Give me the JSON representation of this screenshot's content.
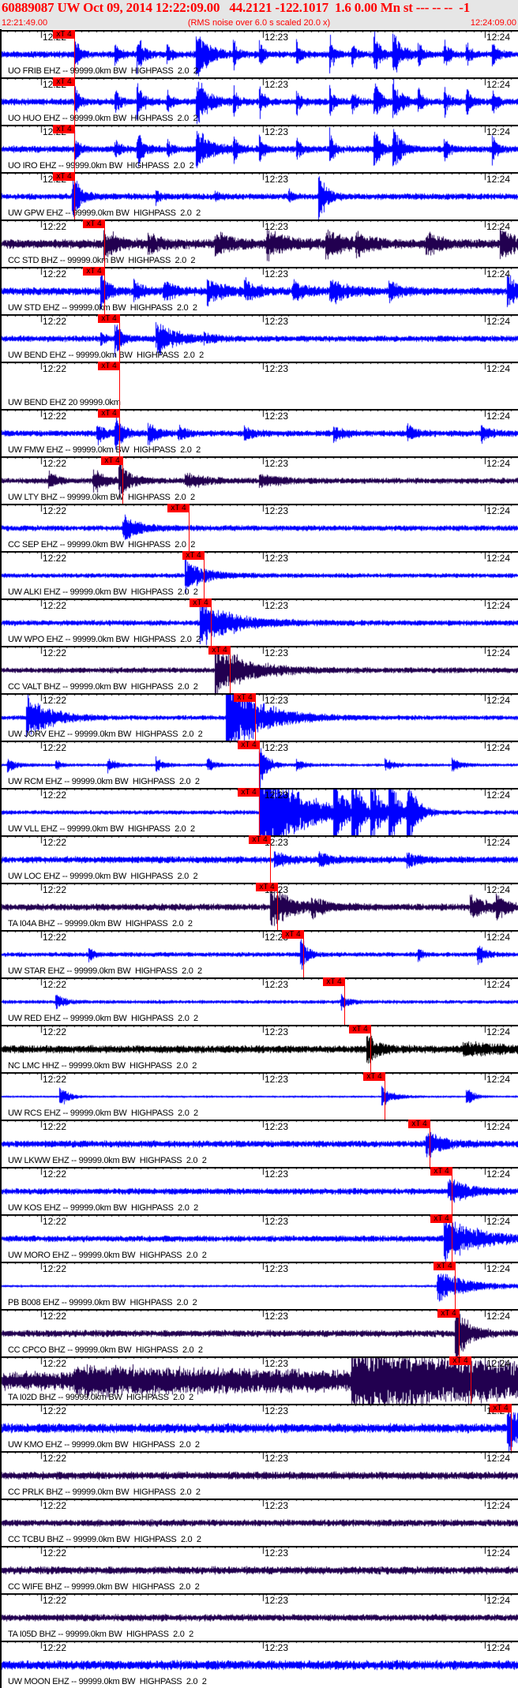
{
  "header": {
    "title": "60889087 UW Oct 09, 2014 12:22:09.00   44.2121 -122.1017  1.6 0.00 Mn st --- -- --  -1",
    "start_time": "12:21:49.00",
    "end_time": "12:24:09.00",
    "rms_note": "(RMS noise over 6.0 s scaled 20.0 x)"
  },
  "axis": {
    "window_seconds": 140,
    "tick_labels": [
      {
        "label": "12:22",
        "t": 11
      },
      {
        "label": "12:23",
        "t": 71
      },
      {
        "label": "12:24",
        "t": 131
      }
    ],
    "pick_label": "xT 4"
  },
  "colors": {
    "blue": "#0000ff",
    "purple": "#220050",
    "black": "#000000",
    "pick": "#ff0000",
    "header_bg": "#e6e6e6"
  },
  "traces": [
    {
      "label": "UO FRIB EHZ -- 99999.0km BW  HIGHPASS  2.0  2",
      "color": "blue",
      "pick_s": 20.1,
      "noise": 0.22,
      "events": [
        [
          20,
          1.3,
          1
        ],
        [
          31,
          0.9,
          1
        ],
        [
          37,
          1.3,
          1.5
        ],
        [
          45,
          0.8,
          1
        ],
        [
          53,
          1.6,
          3
        ],
        [
          63,
          1.0,
          1
        ],
        [
          70,
          1.1,
          1
        ],
        [
          80,
          1.0,
          1
        ],
        [
          89,
          1.3,
          1
        ],
        [
          95,
          0.8,
          1
        ],
        [
          101,
          1.5,
          1.5
        ],
        [
          106,
          1.6,
          2
        ],
        [
          113,
          0.8,
          1
        ],
        [
          120,
          1.3,
          1
        ],
        [
          126,
          0.9,
          1
        ],
        [
          133,
          1.0,
          1
        ]
      ]
    },
    {
      "label": "UO HUO EHZ -- 99999.0km BW  HIGHPASS  2.0  2",
      "color": "blue",
      "pick_s": 20.1,
      "noise": 0.22,
      "events": [
        [
          20,
          1.3,
          1
        ],
        [
          31,
          1.0,
          1
        ],
        [
          37,
          1.2,
          1.5
        ],
        [
          45,
          0.9,
          1
        ],
        [
          53,
          1.6,
          3
        ],
        [
          63,
          1.0,
          1
        ],
        [
          70,
          1.2,
          1
        ],
        [
          80,
          0.9,
          1
        ],
        [
          89,
          1.3,
          1
        ],
        [
          95,
          0.9,
          1
        ],
        [
          101,
          1.6,
          1.5
        ],
        [
          106,
          1.6,
          2
        ],
        [
          113,
          0.9,
          1
        ],
        [
          120,
          1.2,
          1
        ],
        [
          126,
          1.0,
          1
        ],
        [
          133,
          1.0,
          1
        ]
      ]
    },
    {
      "label": "UO IRO EHZ -- 99999.0km BW  HIGHPASS  2.0  2",
      "color": "blue",
      "pick_s": 20.1,
      "noise": 0.22,
      "events": [
        [
          20,
          1.3,
          1
        ],
        [
          31,
          0.8,
          1
        ],
        [
          37,
          1.2,
          1.5
        ],
        [
          45,
          0.8,
          1
        ],
        [
          53,
          1.6,
          3
        ],
        [
          63,
          1.0,
          1
        ],
        [
          70,
          1.2,
          1
        ],
        [
          80,
          0.9,
          1
        ],
        [
          89,
          1.3,
          1
        ],
        [
          101,
          1.6,
          1.5
        ],
        [
          106,
          1.6,
          2
        ],
        [
          120,
          1.2,
          1
        ],
        [
          133,
          1.0,
          1
        ]
      ]
    },
    {
      "label": "UW GPW EHZ -- 99999.0km BW  HIGHPASS  2.0  2",
      "color": "blue",
      "pick_s": 20.1,
      "noise": 0.2,
      "events": [
        [
          19.5,
          1.6,
          2
        ],
        [
          42,
          0.5,
          1
        ],
        [
          58,
          0.4,
          1
        ],
        [
          78,
          0.4,
          1
        ],
        [
          86,
          1.6,
          2
        ]
      ]
    },
    {
      "label": "CC STD BHZ -- 99999.0km BW  HIGHPASS  2.0  2",
      "color": "purple",
      "pick_s": 28.2,
      "noise": 0.3,
      "events": [
        [
          28,
          1.0,
          3
        ],
        [
          40,
          0.6,
          3
        ],
        [
          58,
          0.8,
          4
        ],
        [
          72,
          0.9,
          5
        ],
        [
          88,
          0.8,
          5
        ],
        [
          96,
          0.7,
          3
        ],
        [
          115,
          0.8,
          3
        ],
        [
          135,
          1.2,
          3
        ]
      ]
    },
    {
      "label": "UW STD EHZ -- 99999.0km BW  HIGHPASS  2.0  2",
      "color": "blue",
      "pick_s": 28.2,
      "noise": 0.25,
      "events": [
        [
          27,
          1.4,
          2
        ],
        [
          36,
          0.7,
          2
        ],
        [
          44,
          0.6,
          3
        ],
        [
          56,
          0.9,
          4
        ],
        [
          66,
          0.7,
          3
        ],
        [
          79,
          0.7,
          3
        ],
        [
          89,
          0.9,
          4
        ],
        [
          105,
          0.6,
          3
        ],
        [
          137,
          1.4,
          2
        ]
      ]
    },
    {
      "label": "UW BEND EHZ -- 99999.0km BW  HIGHPASS  2.0  2",
      "color": "blue",
      "pick_s": 32.2,
      "noise": 0.2,
      "events": [
        [
          27,
          0.6,
          1
        ],
        [
          31,
          1.2,
          1.5
        ],
        [
          42,
          1.0,
          5
        ],
        [
          55,
          0.3,
          2
        ]
      ]
    },
    {
      "label": "UW BEND EHZ 20 99999.0km",
      "color": "blue",
      "pick_s": 32.2,
      "noise": 0,
      "events": []
    },
    {
      "label": "UW FMW EHZ -- 99999.0km BW  HIGHPASS  2.0  2",
      "color": "blue",
      "pick_s": 32.2,
      "noise": 0.2,
      "events": [
        [
          26,
          0.8,
          2
        ],
        [
          31,
          1.3,
          2
        ],
        [
          40,
          0.8,
          2
        ],
        [
          48,
          0.5,
          2
        ],
        [
          66,
          0.5,
          2
        ],
        [
          90,
          0.6,
          2
        ],
        [
          110,
          0.6,
          2
        ],
        [
          130,
          0.6,
          2
        ]
      ]
    },
    {
      "label": "UW LTY BHZ -- 99999.0km BW  HIGHPASS  2.0  2",
      "color": "purple",
      "pick_s": 33.1,
      "noise": 0.18,
      "events": [
        [
          13,
          0.6,
          2
        ],
        [
          25,
          0.8,
          3
        ],
        [
          32,
          1.2,
          3
        ],
        [
          50,
          0.5,
          5
        ],
        [
          70,
          0.4,
          5
        ],
        [
          140,
          0.5,
          3
        ]
      ]
    },
    {
      "label": "CC SEP EHZ -- 99999.0km BW  HIGHPASS  2.0  2",
      "color": "blue",
      "pick_s": 51.0,
      "noise": 0.18,
      "events": [
        [
          33,
          0.9,
          4
        ],
        [
          140,
          0.4,
          4
        ]
      ]
    },
    {
      "label": "UW ALKI EHZ -- 99999.0km BW  HIGHPASS  2.0  2",
      "color": "blue",
      "pick_s": 55.1,
      "noise": 0.15,
      "events": [
        [
          50,
          1.0,
          5
        ]
      ]
    },
    {
      "label": "UW WPO EHZ -- 99999.0km BW  HIGHPASS  2.0  2",
      "color": "blue",
      "pick_s": 57.0,
      "noise": 0.18,
      "events": [
        [
          54,
          1.5,
          8
        ]
      ]
    },
    {
      "label": "CC VALT BHZ -- 99999.0km BW  HIGHPASS  2.0  2",
      "color": "purple",
      "pick_s": 62.1,
      "noise": 0.18,
      "events": [
        [
          58,
          1.7,
          8
        ]
      ]
    },
    {
      "label": "UW JORV EHZ -- 99999.0km BW  HIGHPASS  2.0  2",
      "color": "blue",
      "pick_s": 68.9,
      "noise": 0.15,
      "events": [
        [
          7,
          1.5,
          6
        ],
        [
          61,
          3,
          8
        ]
      ]
    },
    {
      "label": "UW RCM EHZ -- 99999.0km BW  HIGHPASS  2.0  2",
      "color": "blue",
      "pick_s": 70.0,
      "noise": 0.1,
      "events": [
        [
          2,
          0.5,
          2
        ],
        [
          15,
          0.5,
          1
        ],
        [
          29,
          0.5,
          2
        ],
        [
          42,
          0.5,
          2
        ],
        [
          56,
          0.4,
          2
        ],
        [
          70,
          1.5,
          2
        ],
        [
          80,
          0.4,
          2
        ],
        [
          104,
          0.5,
          2
        ],
        [
          122,
          0.5,
          2
        ]
      ]
    },
    {
      "label": "UW VLL EHZ -- 99999.0km BW  HIGHPASS  2.0  2",
      "color": "blue",
      "pick_s": 70.0,
      "noise": 0.14,
      "events": [
        [
          70,
          4,
          9
        ],
        [
          90,
          3,
          2
        ],
        [
          95,
          3,
          2
        ],
        [
          100,
          3,
          2
        ],
        [
          105,
          3,
          2
        ],
        [
          110,
          3,
          2
        ]
      ]
    },
    {
      "label": "UW LOC EHZ -- 99999.0km BW  HIGHPASS  2.0  2",
      "color": "blue",
      "pick_s": 73.0,
      "noise": 0.22,
      "events": [
        [
          74,
          0.5,
          3
        ],
        [
          86,
          0.5,
          3
        ],
        [
          110,
          0.4,
          3
        ]
      ]
    },
    {
      "label": "TA I04A BHZ -- 99999.0km BW  HIGHPASS  2.0  2",
      "color": "purple",
      "pick_s": 74.9,
      "noise": 0.22,
      "events": [
        [
          73,
          1.2,
          6
        ],
        [
          84,
          0.5,
          4
        ],
        [
          127,
          0.8,
          4
        ],
        [
          134,
          0.7,
          3
        ]
      ]
    },
    {
      "label": "UW STAR EHZ -- 99999.0km BW  HIGHPASS  2.0  2",
      "color": "blue",
      "pick_s": 81.9,
      "noise": 0.15,
      "events": [
        [
          24,
          0.6,
          1
        ],
        [
          81,
          1.4,
          1.5
        ],
        [
          113,
          0.5,
          1
        ],
        [
          129,
          0.7,
          2
        ]
      ]
    },
    {
      "label": "UW RED EHZ -- 99999.0km BW  HIGHPASS  2.0  2",
      "color": "blue",
      "pick_s": 93.0,
      "noise": 0.12,
      "events": [
        [
          15,
          0.5,
          2
        ],
        [
          92,
          0.5,
          2
        ]
      ]
    },
    {
      "label": "NC LMC HHZ -- 99999.0km BW  HIGHPASS  2.0  2",
      "color": "black",
      "pick_s": 100.1,
      "noise": 0.25,
      "events": [
        [
          99,
          0.9,
          3
        ],
        [
          125,
          0.4,
          10
        ]
      ]
    },
    {
      "label": "UW RCS EHZ -- 99999.0km BW  HIGHPASS  2.0  2",
      "color": "blue",
      "pick_s": 103.9,
      "noise": 0.07,
      "events": [
        [
          16,
          0.8,
          2
        ],
        [
          103,
          0.7,
          3
        ],
        [
          126,
          0.6,
          2
        ]
      ]
    },
    {
      "label": "UW LKWW EHZ -- 99999.0km BW  HIGHPASS  2.0  2",
      "color": "blue",
      "pick_s": 116.1,
      "noise": 0.22,
      "events": [
        [
          115,
          0.9,
          4
        ]
      ]
    },
    {
      "label": "UW KOS EHZ -- 99999.0km BW  HIGHPASS  2.0  2",
      "color": "blue",
      "pick_s": 122.1,
      "noise": 0.2,
      "events": [
        [
          121,
          0.9,
          5
        ]
      ]
    },
    {
      "label": "UW MORO EHZ -- 99999.0km BW  HIGHPASS  2.0  2",
      "color": "blue",
      "pick_s": 122.1,
      "noise": 0.2,
      "events": [
        [
          120,
          1.5,
          8
        ]
      ]
    },
    {
      "label": "PB B008 EHZ -- 99999.0km BW  HIGHPASS  2.0  2",
      "color": "blue",
      "pick_s": 122.9,
      "noise": 0.08,
      "events": [
        [
          118,
          1.0,
          8
        ]
      ]
    },
    {
      "label": "CC CPCO BHZ -- 99999.0km BW  HIGHPASS  2.0  2",
      "color": "purple",
      "pick_s": 124.0,
      "noise": 0.22,
      "events": [
        [
          123,
          2,
          3
        ]
      ]
    },
    {
      "label": "TA I02D BHZ -- 99999.0km BW  HIGHPASS  2.0  2",
      "color": "purple",
      "pick_s": 127.2,
      "noise": 0.6,
      "events": [
        [
          20,
          0.5,
          60
        ],
        [
          95,
          1.5,
          60
        ]
      ]
    },
    {
      "label": "UW KMO EHZ -- 99999.0km BW  HIGHPASS  2.0  2",
      "color": "blue",
      "pick_s": 138.1,
      "noise": 0.3,
      "events": [
        [
          137,
          1.8,
          4
        ]
      ]
    },
    {
      "label": "CC PRLK BHZ -- 99999.0km BW  HIGHPASS  2.0  2",
      "color": "purple",
      "pick_s": null,
      "noise": 0.25,
      "events": []
    },
    {
      "label": "CC TCBU BHZ -- 99999.0km BW  HIGHPASS  2.0  2",
      "color": "purple",
      "pick_s": null,
      "noise": 0.22,
      "events": []
    },
    {
      "label": "CC WIFE BHZ -- 99999.0km BW  HIGHPASS  2.0  2",
      "color": "purple",
      "pick_s": null,
      "noise": 0.25,
      "events": []
    },
    {
      "label": "TA I05D BHZ -- 99999.0km BW  HIGHPASS  2.0  2",
      "color": "purple",
      "pick_s": null,
      "noise": 0.22,
      "events": []
    },
    {
      "label": "UW MOON EHZ -- 99999.0km BW  HIGHPASS  2.0  2",
      "color": "blue",
      "pick_s": null,
      "noise": 0.3,
      "events": []
    }
  ]
}
